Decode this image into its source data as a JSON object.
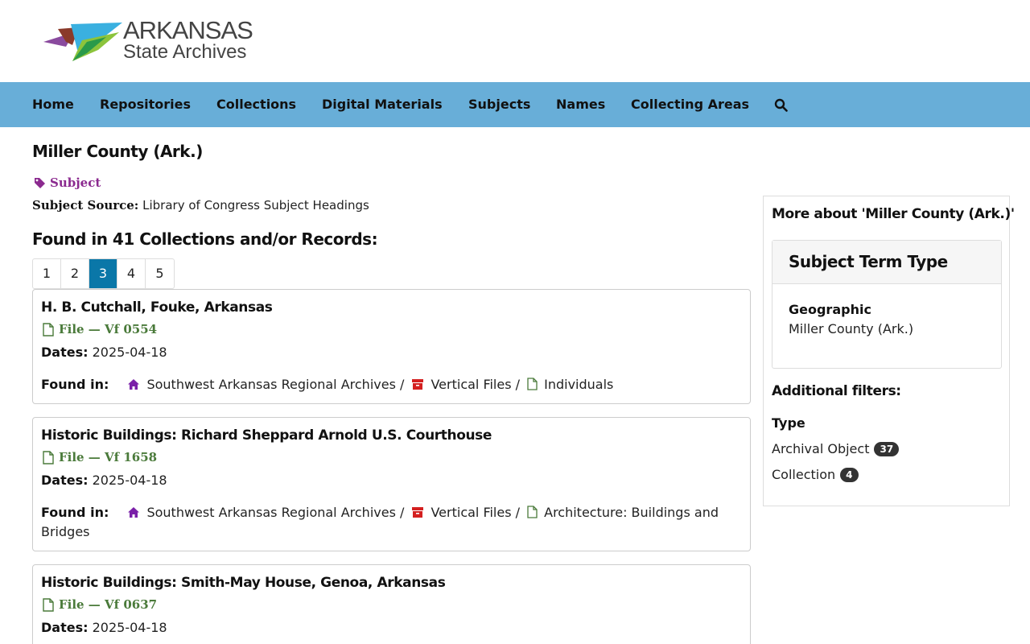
{
  "header": {
    "logo_line1": "ARKANSAS",
    "logo_line2": "State Archives"
  },
  "nav": {
    "items": [
      "Home",
      "Repositories",
      "Collections",
      "Digital Materials",
      "Subjects",
      "Names",
      "Collecting Areas"
    ],
    "search_icon": "search-icon"
  },
  "page": {
    "title": "Miller County (Ark.)",
    "badge": "Subject",
    "subject_source_label": "Subject Source:",
    "subject_source_value": "Library of Congress Subject Headings",
    "found_heading": "Found in 41 Collections and/or Records:"
  },
  "pagination": {
    "pages": [
      "1",
      "2",
      "3",
      "4",
      "5"
    ],
    "active": "3"
  },
  "records": [
    {
      "title": "H. B. Cutchall, Fouke, Arkansas",
      "type": "File — Vf 0554",
      "dates_label": "Dates:",
      "dates": "2025-04-18",
      "found_label": "Found in:",
      "repository": "Southwest Arkansas Regional Archives",
      "series": "Vertical Files",
      "subseries": "Individuals"
    },
    {
      "title": "Historic Buildings: Richard Sheppard Arnold U.S. Courthouse",
      "type": "File — Vf 1658",
      "dates_label": "Dates:",
      "dates": "2025-04-18",
      "found_label": "Found in:",
      "repository": "Southwest Arkansas Regional Archives",
      "series": "Vertical Files",
      "subseries": "Architecture: Buildings and Bridges"
    },
    {
      "title": "Historic Buildings: Smith-May House, Genoa, Arkansas",
      "type": "File — Vf 0637",
      "dates_label": "Dates:",
      "dates": "2025-04-18"
    }
  ],
  "sidebar": {
    "title": "More about 'Miller County (Ark.)'",
    "card_title": "Subject Term Type",
    "term_label": "Geographic",
    "term_value": "Miller County (Ark.)",
    "additional_filters": "Additional filters:",
    "filter_type_label": "Type",
    "filters": [
      {
        "label": "Archival Object",
        "count": "37"
      },
      {
        "label": "Collection",
        "count": "4"
      }
    ]
  },
  "colors": {
    "nav_bg": "#68aed8",
    "active_page": "#0a77a8",
    "subject_badge": "#8b2a8f",
    "file_type": "#4a7a3a",
    "repo_icon": "#7a1fa8",
    "series_icon": "#d42020"
  }
}
